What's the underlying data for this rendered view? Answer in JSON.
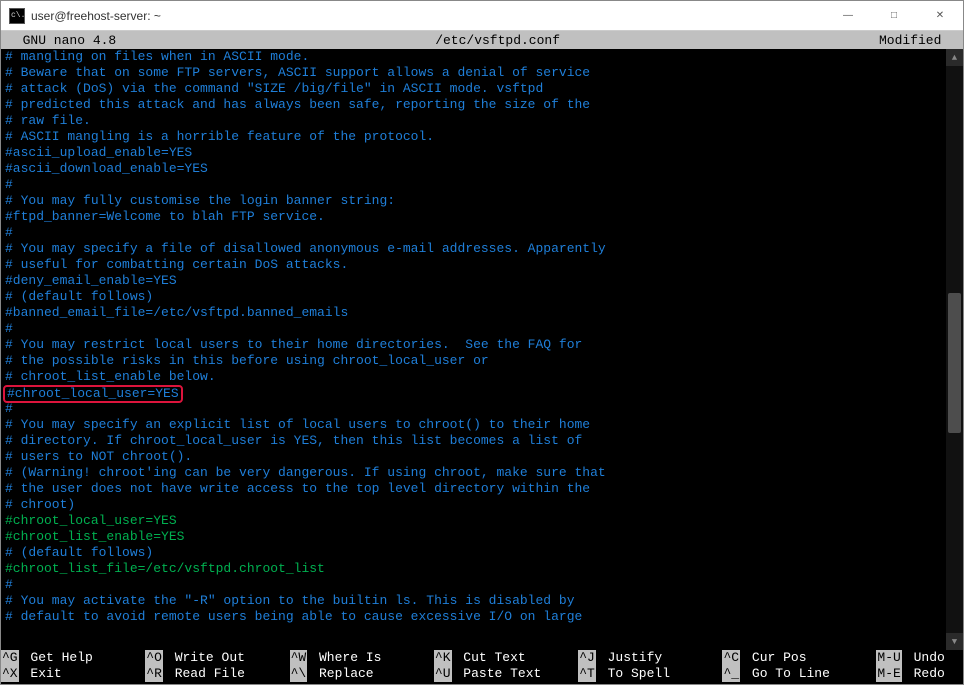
{
  "window": {
    "title": "user@freehost-server: ~"
  },
  "nano_header": {
    "app": "  GNU nano 4.8",
    "file": "/etc/vsftpd.conf",
    "status": "Modified  "
  },
  "lines": [
    "# mangling on files when in ASCII mode.",
    "# Beware that on some FTP servers, ASCII support allows a denial of service",
    "# attack (DoS) via the command \"SIZE /big/file\" in ASCII mode. vsftpd",
    "# predicted this attack and has always been safe, reporting the size of the",
    "# raw file.",
    "# ASCII mangling is a horrible feature of the protocol.",
    "#ascii_upload_enable=YES",
    "#ascii_download_enable=YES",
    "#",
    "# You may fully customise the login banner string:",
    "#ftpd_banner=Welcome to blah FTP service.",
    "#",
    "# You may specify a file of disallowed anonymous e-mail addresses. Apparently",
    "# useful for combatting certain DoS attacks.",
    "#deny_email_enable=YES",
    "# (default follows)",
    "#banned_email_file=/etc/vsftpd.banned_emails",
    "#",
    "# You may restrict local users to their home directories.  See the FAQ for",
    "# the possible risks in this before using chroot_local_user or",
    "# chroot_list_enable below.",
    "#chroot_local_user=YES",
    "#",
    "# You may specify an explicit list of local users to chroot() to their home",
    "# directory. If chroot_local_user is YES, then this list becomes a list of",
    "# users to NOT chroot().",
    "# (Warning! chroot'ing can be very dangerous. If using chroot, make sure that",
    "# the user does not have write access to the top level directory within the",
    "# chroot)",
    "#chroot_local_user=YES",
    "#chroot_list_enable=YES",
    "# (default follows)",
    "#chroot_list_file=/etc/vsftpd.chroot_list",
    "#",
    "# You may activate the \"-R\" option to the builtin ls. This is disabled by",
    "# default to avoid remote users being able to cause excessive I/O on large"
  ],
  "highlight_index": 21,
  "green_indices": [
    29,
    30,
    32
  ],
  "shortcuts": {
    "row1": [
      {
        "key": "^G",
        "label": "Get Help"
      },
      {
        "key": "^O",
        "label": "Write Out"
      },
      {
        "key": "^W",
        "label": "Where Is"
      },
      {
        "key": "^K",
        "label": "Cut Text"
      },
      {
        "key": "^J",
        "label": "Justify"
      },
      {
        "key": "^C",
        "label": "Cur Pos"
      },
      {
        "key": "M-U",
        "label": "Undo"
      }
    ],
    "row2": [
      {
        "key": "^X",
        "label": "Exit"
      },
      {
        "key": "^R",
        "label": "Read File"
      },
      {
        "key": "^\\",
        "label": "Replace"
      },
      {
        "key": "^U",
        "label": "Paste Text"
      },
      {
        "key": "^T",
        "label": "To Spell"
      },
      {
        "key": "^_",
        "label": "Go To Line"
      },
      {
        "key": "M-E",
        "label": "Redo"
      }
    ]
  }
}
